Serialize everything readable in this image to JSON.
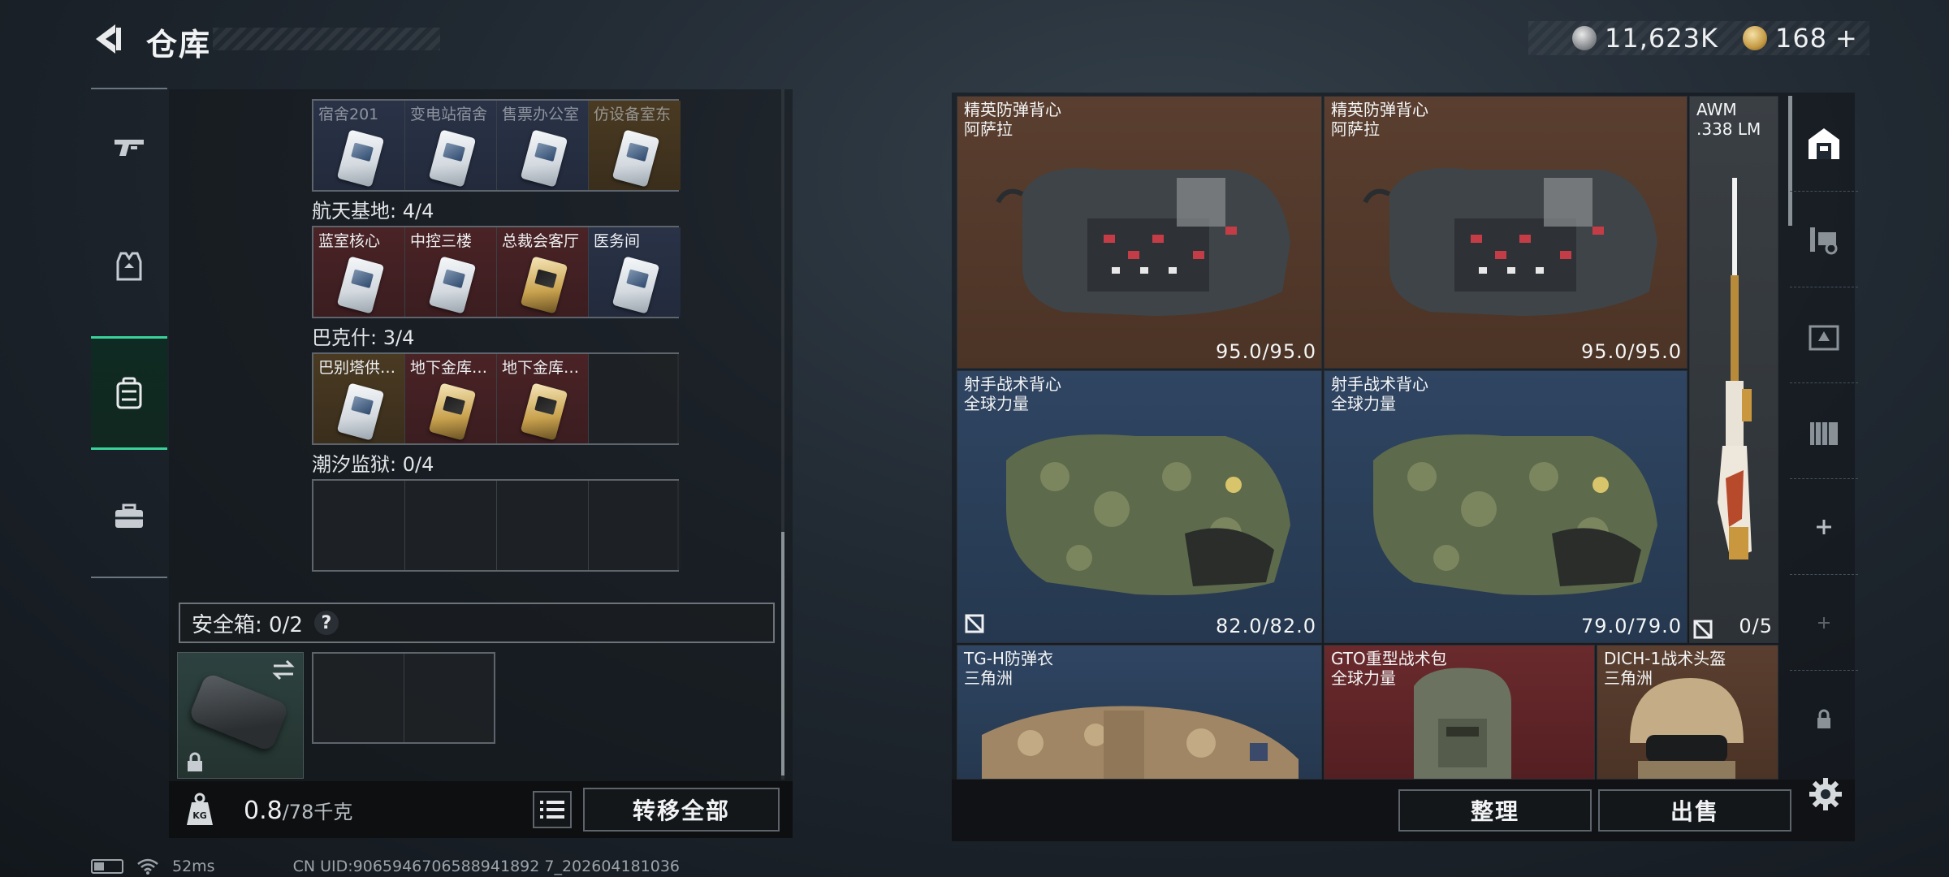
{
  "header": {
    "title": "仓库",
    "currency_silver": "11,623K",
    "currency_gold": "168",
    "currency_gold_plus": "+"
  },
  "left_nav": {
    "items": [
      "weapons",
      "equipment",
      "backpack",
      "toolbox"
    ],
    "active_index": 2
  },
  "keycards": {
    "top_row": [
      {
        "label": "宿舍201",
        "color": "blue"
      },
      {
        "label": "变电站宿舍",
        "color": "blue"
      },
      {
        "label": "售票办公室",
        "color": "blue"
      },
      {
        "label": "仿设备室东",
        "color": "gold"
      }
    ],
    "sections": [
      {
        "label": "航天基地: 4/4",
        "cards": [
          {
            "label": "蓝室核心",
            "color": "red"
          },
          {
            "label": "中控三楼",
            "color": "red"
          },
          {
            "label": "总裁会客厅",
            "color": "red"
          },
          {
            "label": "医务间",
            "color": "blue"
          }
        ]
      },
      {
        "label": "巴克什: 3/4",
        "cards": [
          {
            "label": "巴别塔供…",
            "color": "red"
          },
          {
            "label": "地下金库…",
            "color": "red"
          },
          {
            "label": "地下金库…",
            "color": "red"
          },
          {
            "label": "",
            "color": "empty"
          }
        ]
      },
      {
        "label": "潮汐监狱: 0/4",
        "cards": [
          {
            "label": "",
            "color": "empty"
          },
          {
            "label": "",
            "color": "empty"
          },
          {
            "label": "",
            "color": "empty"
          },
          {
            "label": "",
            "color": "empty"
          }
        ]
      }
    ]
  },
  "safebox": {
    "label": "安全箱: 0/2",
    "help": "?"
  },
  "bottom_left": {
    "weight_current": "0.8",
    "weight_max": "/78千克",
    "transfer_all": "转移全部"
  },
  "items": [
    {
      "name1": "精英防弹背心",
      "name2": "阿萨拉",
      "durability": "95.0/95.0",
      "color": "brown"
    },
    {
      "name1": "精英防弹背心",
      "name2": "阿萨拉",
      "durability": "95.0/95.0",
      "color": "brown"
    },
    {
      "name1": "AWM",
      "name2": ".338 LM",
      "durability": "0/5",
      "color": "gray"
    },
    {
      "name1": "射手战术背心",
      "name2": "全球力量",
      "durability": "82.0/82.0",
      "color": "navy"
    },
    {
      "name1": "射手战术背心",
      "name2": "全球力量",
      "durability": "79.0/79.0",
      "color": "navy"
    },
    {
      "name1": "TG-H防弹衣",
      "name2": "三角洲",
      "durability": "",
      "color": "navy"
    },
    {
      "name1": "GTO重型战术包",
      "name2": "全球力量",
      "durability": "",
      "color": "red"
    },
    {
      "name1": "DICH-1战术头盔",
      "name2": "三角洲",
      "durability": "",
      "color": "brown"
    }
  ],
  "actions": {
    "sort": "整理",
    "sell": "出售"
  },
  "status": {
    "ping": "52ms",
    "uid": "CN UID:9065946706588941892 7_202604181036"
  }
}
